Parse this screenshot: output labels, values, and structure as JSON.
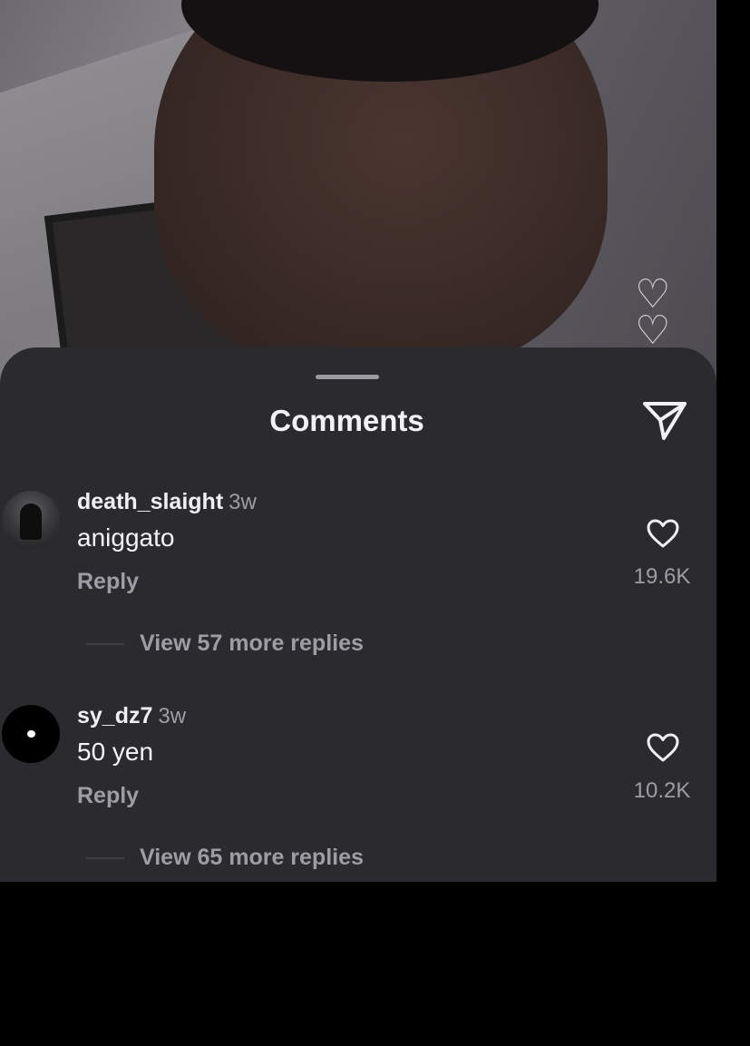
{
  "sheet": {
    "title": "Comments"
  },
  "comments": [
    {
      "username": "death_slaight",
      "time": "3w",
      "text": "aniggato",
      "reply_label": "Reply",
      "likes": "19.6K",
      "view_replies": "View 57 more replies"
    },
    {
      "username": "sy_dz7",
      "time": "3w",
      "text": "50 yen",
      "reply_label": "Reply",
      "likes": "10.2K",
      "view_replies": "View 65 more replies"
    }
  ],
  "icons": {
    "send": "send-icon",
    "like": "heart-outline-icon",
    "floating": "floating-heart-icon"
  },
  "colors": {
    "sheet_bg": "#2b2b2f",
    "text_primary": "#f0f0f2",
    "text_secondary": "#9d9da3"
  }
}
